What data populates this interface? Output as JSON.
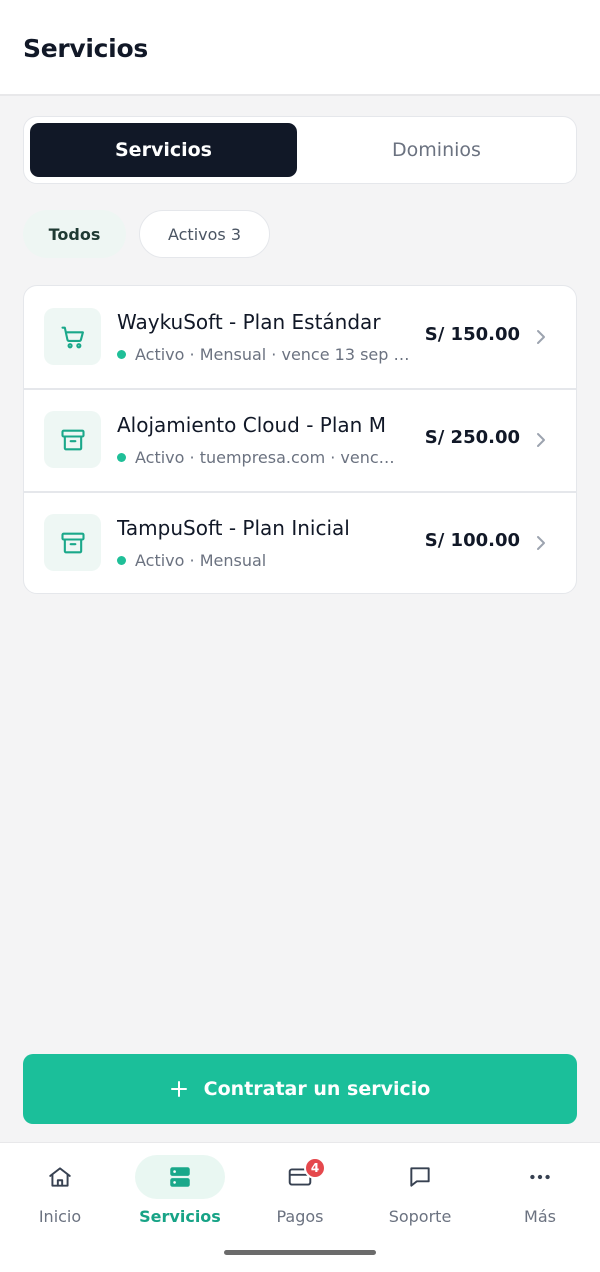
{
  "header": {
    "title": "Servicios"
  },
  "segment": {
    "tabs": [
      {
        "label": "Servicios",
        "active": true
      },
      {
        "label": "Dominios",
        "active": false
      }
    ]
  },
  "filters": {
    "all": "Todos",
    "active": "Activos 3"
  },
  "services": [
    {
      "title": "WaykuSoft - Plan Estándar",
      "status": "Activo",
      "subtitle": "Activo · Mensual · vence 13 sep …",
      "price": "S/ 150.00",
      "icon": "cart-icon"
    },
    {
      "title": "Alojamiento Cloud - Plan M",
      "status": "Activo",
      "subtitle": "Activo · tuempresa.com · venc…",
      "price": "S/ 250.00",
      "icon": "archive-icon"
    },
    {
      "title": "TampuSoft - Plan Inicial",
      "status": "Activo",
      "subtitle": "Activo · Mensual",
      "price": "S/ 100.00",
      "icon": "archive-icon"
    }
  ],
  "cta": {
    "label": "Contratar un servicio"
  },
  "tabbar": {
    "items": [
      {
        "label": "Inicio",
        "icon": "home-icon"
      },
      {
        "label": "Servicios",
        "icon": "server-icon",
        "active": true
      },
      {
        "label": "Pagos",
        "icon": "card-icon",
        "badge": "4"
      },
      {
        "label": "Soporte",
        "icon": "chat-icon"
      },
      {
        "label": "Más",
        "icon": "more-icon"
      }
    ]
  },
  "colors": {
    "accent": "#1bbf9a",
    "dark": "#111827",
    "status_active": "#1fbf98",
    "badge": "#e5484d"
  }
}
